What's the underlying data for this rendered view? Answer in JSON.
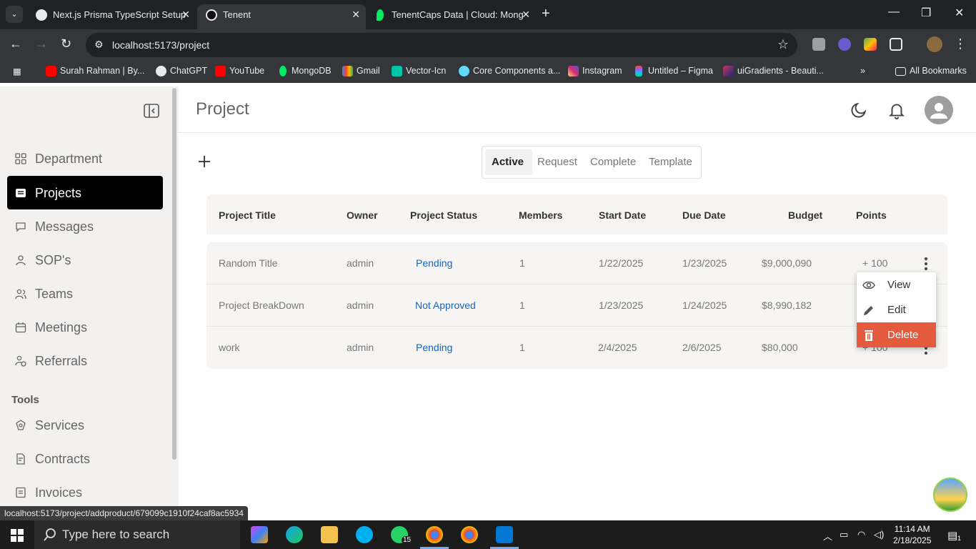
{
  "browser": {
    "tabs": [
      {
        "title": "Next.js Prisma TypeScript Setup",
        "active": false
      },
      {
        "title": "Tenent",
        "active": true
      },
      {
        "title": "TenentCaps Data | Cloud: Mong",
        "active": false
      }
    ],
    "url": "localhost:5173/project",
    "bookmarks": [
      "Surah Rahman | By...",
      "ChatGPT",
      "YouTube",
      "MongoDB",
      "Gmail",
      "Vector-Icn",
      "Core Components a...",
      "Instagram",
      "Untitled – Figma",
      "uiGradients - Beauti..."
    ],
    "all_bookmarks": "All Bookmarks",
    "status_url": "localhost:5173/project/addproduct/679099c1910f24caf8ac5934"
  },
  "sidebar": {
    "items": [
      {
        "label": "Department",
        "icon": "grid-icon",
        "active": false
      },
      {
        "label": "Projects",
        "icon": "projects-icon",
        "active": true
      },
      {
        "label": "Messages",
        "icon": "chat-icon",
        "active": false
      },
      {
        "label": "SOP's",
        "icon": "person-icon",
        "active": false
      },
      {
        "label": "Teams",
        "icon": "team-icon",
        "active": false
      },
      {
        "label": "Meetings",
        "icon": "calendar-icon",
        "active": false
      },
      {
        "label": "Referrals",
        "icon": "referral-icon",
        "active": false
      }
    ],
    "tools_label": "Tools",
    "tools": [
      {
        "label": "Services",
        "icon": "services-icon"
      },
      {
        "label": "Contracts",
        "icon": "contract-icon"
      },
      {
        "label": "Invoices",
        "icon": "invoice-icon"
      }
    ]
  },
  "header": {
    "title": "Project"
  },
  "tabs": [
    "Active",
    "Request",
    "Complete",
    "Template"
  ],
  "table": {
    "columns": [
      "Project Title",
      "Owner",
      "Project Status",
      "Members",
      "Start Date",
      "Due Date",
      "Budget",
      "Points"
    ],
    "rows": [
      {
        "title": "Random Title",
        "owner": "admin",
        "status": "Pending",
        "members": "1",
        "start": "1/22/2025",
        "due": "1/23/2025",
        "budget": "$9,000,090",
        "points": "+ 100"
      },
      {
        "title": "Project BreakDown",
        "owner": "admin",
        "status": "Not Approved",
        "members": "1",
        "start": "1/23/2025",
        "due": "1/24/2025",
        "budget": "$8,990,182",
        "points": ""
      },
      {
        "title": "work",
        "owner": "admin",
        "status": "Pending",
        "members": "1",
        "start": "2/4/2025",
        "due": "2/6/2025",
        "budget": "$80,000",
        "points": "+ 100"
      }
    ]
  },
  "row_menu": {
    "items": [
      {
        "label": "View",
        "icon": "eye-icon"
      },
      {
        "label": "Edit",
        "icon": "pencil-icon"
      },
      {
        "label": "Delete",
        "icon": "trash-icon"
      }
    ]
  },
  "taskbar": {
    "search_placeholder": "Type here to search",
    "time": "11:14 AM",
    "date": "2/18/2025",
    "whatsapp_badge": "15",
    "notification_count": "1"
  },
  "colors": {
    "active_nav": "#000000",
    "status_text": "#1565c0",
    "delete_bg": "#e35a3f"
  }
}
